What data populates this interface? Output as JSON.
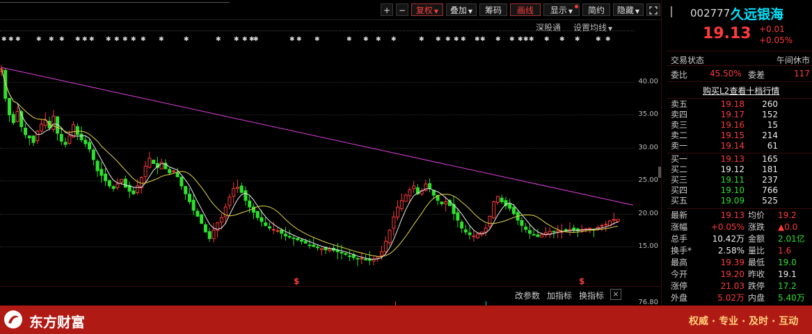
{
  "toolbar": {
    "plus": "+",
    "minus": "−",
    "fuquan": "复权",
    "diejia": "叠加",
    "chouma": "筹码",
    "huaxian": "画线",
    "xianshi": "显示",
    "jianyue": "简约",
    "yincang": "隐藏",
    "expand_icon": "expand-icon"
  },
  "chart_toolbar": {
    "shengutong": "深股通",
    "set_ma": "设置均线"
  },
  "y_axis": [
    "40.00",
    "35.00",
    "30.00",
    "25.00",
    "20.00",
    "15.00"
  ],
  "indicator": {
    "gai_canshu": "改参数",
    "jia_zhibiao": "加指标",
    "huan_zhibiao": "换指标",
    "close": "×",
    "ytick": "76.80"
  },
  "markers": {
    "dividend_symbol": "$"
  },
  "stock": {
    "code": "002777",
    "name": "久远银海",
    "price": "19.13",
    "change": "+0.01",
    "change_pct": "+0.05%"
  },
  "status": {
    "label": "交易状态",
    "value": "午间休市"
  },
  "weibi": {
    "label1": "委比",
    "value1": "45.50%",
    "label2": "委差",
    "value2": "117"
  },
  "l2_link": "购买L2查看十档行情",
  "sell": [
    {
      "label": "卖五",
      "price": "19.18",
      "vol": "260"
    },
    {
      "label": "卖四",
      "price": "19.17",
      "vol": "152"
    },
    {
      "label": "卖三",
      "price": "19.16",
      "vol": "15"
    },
    {
      "label": "卖二",
      "price": "19.15",
      "vol": "214"
    },
    {
      "label": "卖一",
      "price": "19.14",
      "vol": "61"
    }
  ],
  "buy": [
    {
      "label": "买一",
      "price": "19.13",
      "vol": "165"
    },
    {
      "label": "买二",
      "price": "19.12",
      "vol": "181"
    },
    {
      "label": "买三",
      "price": "19.11",
      "vol": "237"
    },
    {
      "label": "买四",
      "price": "19.10",
      "vol": "766"
    },
    {
      "label": "买五",
      "price": "19.09",
      "vol": "525"
    }
  ],
  "quote": [
    {
      "l1": "最新",
      "v1": "19.13",
      "l2": "均价",
      "v2": "19.2"
    },
    {
      "l1": "涨幅",
      "v1": "+0.05%",
      "l2": "涨跌",
      "v2": "▲0.0"
    },
    {
      "l1": "总手",
      "v1": "10.42万",
      "l2": "金额",
      "v2": "2.01亿"
    },
    {
      "l1": "换手*",
      "v1": "2.58%",
      "l2": "量比",
      "v2": "1.6"
    },
    {
      "l1": "最高",
      "v1": "19.39",
      "l2": "最低",
      "v2": "19.0"
    },
    {
      "l1": "今开",
      "v1": "19.20",
      "l2": "昨收",
      "v2": "19.1"
    },
    {
      "l1": "涨停",
      "v1": "21.03",
      "l2": "跌停",
      "v2": "17.2"
    },
    {
      "l1": "外盘",
      "v1": "5.02万",
      "l2": "内盘",
      "v2": "5.40万"
    }
  ],
  "footer": {
    "brand": "东方财富",
    "slogan": "权威 · 专业 · 及时 · 互动"
  },
  "colors": {
    "up": "#ff3b3b",
    "down": "#2ee02e",
    "cyan": "#00e5ff",
    "trendline": "#e040e0",
    "ma_white": "#f0f0f0",
    "ma_yellow": "#e8d84a",
    "footer_bg": "#b01a14"
  },
  "chart_data": {
    "type": "candlestick",
    "ylim": [
      12,
      42
    ],
    "close_series": [
      42.0,
      37.5,
      35.0,
      33.8,
      35.5,
      33.2,
      32.0,
      31.5,
      30.8,
      32.5,
      33.6,
      34.2,
      33.0,
      34.8,
      32.2,
      31.0,
      30.5,
      31.8,
      33.5,
      32.0,
      31.2,
      30.6,
      29.8,
      28.2,
      26.5,
      25.8,
      25.0,
      24.2,
      23.8,
      24.5,
      25.2,
      24.0,
      23.4,
      23.0,
      24.2,
      25.5,
      27.2,
      28.4,
      27.6,
      27.0,
      27.8,
      26.8,
      26.2,
      26.5,
      25.6,
      24.2,
      23.0,
      21.8,
      20.5,
      19.6,
      18.5,
      17.2,
      16.2,
      17.5,
      18.6,
      19.4,
      21.0,
      22.5,
      23.8,
      24.0,
      23.2,
      22.0,
      21.0,
      20.2,
      19.4,
      18.8,
      18.2,
      17.8,
      17.6,
      17.4,
      17.0,
      16.6,
      16.4,
      16.2,
      16.0,
      15.8,
      15.5,
      15.2,
      15.0,
      14.8,
      14.7,
      14.5,
      14.6,
      14.4,
      14.2,
      14.0,
      13.8,
      13.5,
      13.3,
      13.1,
      13.2,
      13.0,
      12.9,
      13.1,
      13.4,
      14.2,
      15.8,
      17.5,
      19.5,
      21.0,
      22.0,
      22.8,
      23.6,
      24.2,
      23.0,
      23.5,
      24.5,
      23.8,
      22.8,
      22.0,
      21.5,
      21.8,
      21.2,
      20.0,
      19.0,
      17.8,
      17.2,
      16.8,
      16.6,
      16.9,
      17.2,
      17.8,
      19.6,
      21.8,
      22.6,
      21.8,
      21.2,
      20.8,
      20.0,
      19.0,
      18.2,
      17.6,
      17.0,
      16.8,
      16.5,
      16.8,
      17.1,
      17.3,
      17.2,
      17.4,
      17.3,
      17.5,
      17.6,
      17.5,
      17.4,
      17.6,
      17.7,
      17.8,
      17.6,
      17.9,
      18.2,
      18.4,
      18.9,
      19.1,
      19.13
    ],
    "ma_white": "moving average 10",
    "ma_yellow": "moving average 20",
    "trendline": {
      "from": [
        0,
        42.2
      ],
      "to": [
        160,
        21.0
      ]
    }
  }
}
